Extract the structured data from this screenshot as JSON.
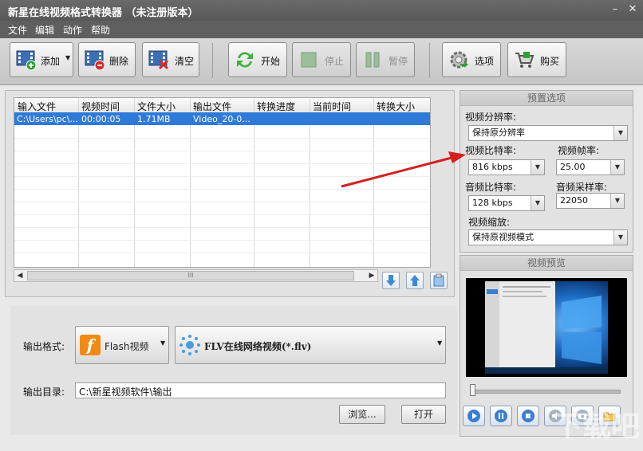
{
  "window": {
    "title": "新星在线视频格式转换器 （未注册版本）",
    "min_glyph": "–",
    "close_glyph": "✕"
  },
  "menu": [
    "文件",
    "编辑",
    "动作",
    "帮助"
  ],
  "toolbar": {
    "add": "添加",
    "delete": "删除",
    "clear": "清空",
    "start": "开始",
    "stop": "停止",
    "pause": "暂停",
    "options": "选项",
    "buy": "购买"
  },
  "file_table": {
    "columns": [
      "输入文件",
      "视频时间",
      "文件大小",
      "输出文件",
      "转换进度",
      "当前时间",
      "转换大小"
    ],
    "rows": [
      [
        "C:\\Users\\pc\\...",
        "00:00:05",
        "1.71MB",
        "Video_20-0...",
        "",
        "",
        ""
      ]
    ],
    "scroll_grip": "III"
  },
  "output": {
    "format_label": "输出格式:",
    "format_type": "Flash视频",
    "format_detail": "FLV在线网络视频(*.flv)",
    "format_icon_letter": "f",
    "dir_label": "输出目录:",
    "dir_value": "C:\\新星视频软件\\输出",
    "browse": "浏览...",
    "open": "打开"
  },
  "preset": {
    "title": "预置选项",
    "resolution_label": "视频分辨率:",
    "resolution_value": "保持原分辨率",
    "vbitrate_label": "视频比特率:",
    "vbitrate_value": "816 kbps",
    "framerate_label": "视频帧率:",
    "framerate_value": "25.00",
    "abitrate_label": "音频比特率:",
    "abitrate_value": "128 kbps",
    "samplerate_label": "音频采样率:",
    "samplerate_value": "22050",
    "scale_label": "视频缩放:",
    "scale_value": "保持原视频模式"
  },
  "preview": {
    "title": "视频预览"
  },
  "watermark": "下载吧",
  "colors": {
    "accent_selected": "#2f7ad8",
    "annotation_arrow": "#d42020",
    "flash_orange": "#f08a12"
  }
}
